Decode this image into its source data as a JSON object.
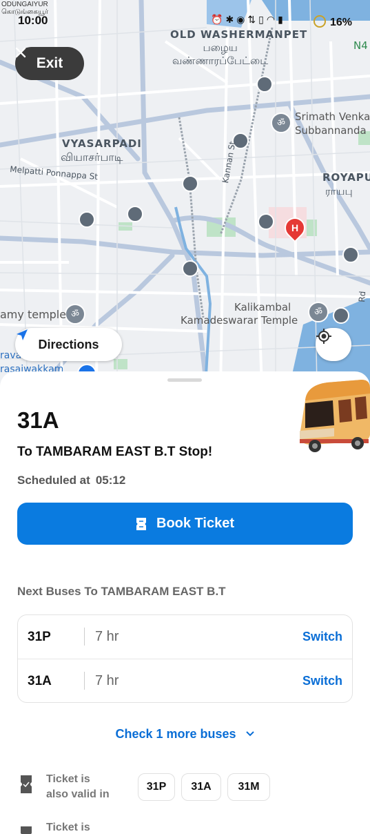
{
  "status_bar": {
    "time": "10:00",
    "place": "ODUNGAIYUR\nகொடுங்கையூர்",
    "battery": "16%"
  },
  "map": {
    "labels": {
      "old_washermanpet": "OLD WASHERMANPET",
      "old_washermanpet_ta": "பழைய\nவண்ணாரப்பேட்டை",
      "vyasarpadi": "VYASARPADI",
      "vyasarpadi_ta": "வியாசர்பாடி",
      "melpatti": "Melpatti Ponnappa St",
      "kannan": "Kannan St",
      "royapuram": "ROYAPU",
      "royapuram_ta": "ராயபு",
      "srimath": "Srimath Venka",
      "subbannanda": "Subbannanda",
      "amy_temple": "amy temple",
      "kalikambal": "Kalikambal",
      "kamadeswarar": "Kamadeswarar Temple",
      "rd": "Rd",
      "n4": "N4",
      "rava": "rava",
      "rasaiwakkam": "rasaiwakkam"
    },
    "exit_label": "Exit",
    "directions_label": "Directions"
  },
  "sheet": {
    "route": "31A",
    "destination": "To TAMBARAM EAST B.T Stop!",
    "scheduled_label": "Scheduled at",
    "scheduled_time": "05:12",
    "book_label": "Book Ticket",
    "next_title": "Next Buses To TAMBARAM EAST B.T",
    "next_buses": [
      {
        "number": "31P",
        "eta": "7 hr",
        "action": "Switch"
      },
      {
        "number": "31A",
        "eta": "7 hr",
        "action": "Switch"
      }
    ],
    "more_label": "Check 1 more buses",
    "valid_label": "Ticket is\nalso valid in",
    "valid_routes": [
      "31P",
      "31A",
      "31M"
    ],
    "valid_label_2": "Ticket is"
  },
  "colors": {
    "accent": "#0a7be0",
    "link": "#0a6ed6",
    "map_bg": "#eef0f3",
    "road": "#ffffff",
    "highway": "#b9c8de",
    "water": "#7fb2e0",
    "park": "#bfe3c7",
    "hospital": "#e53935"
  }
}
